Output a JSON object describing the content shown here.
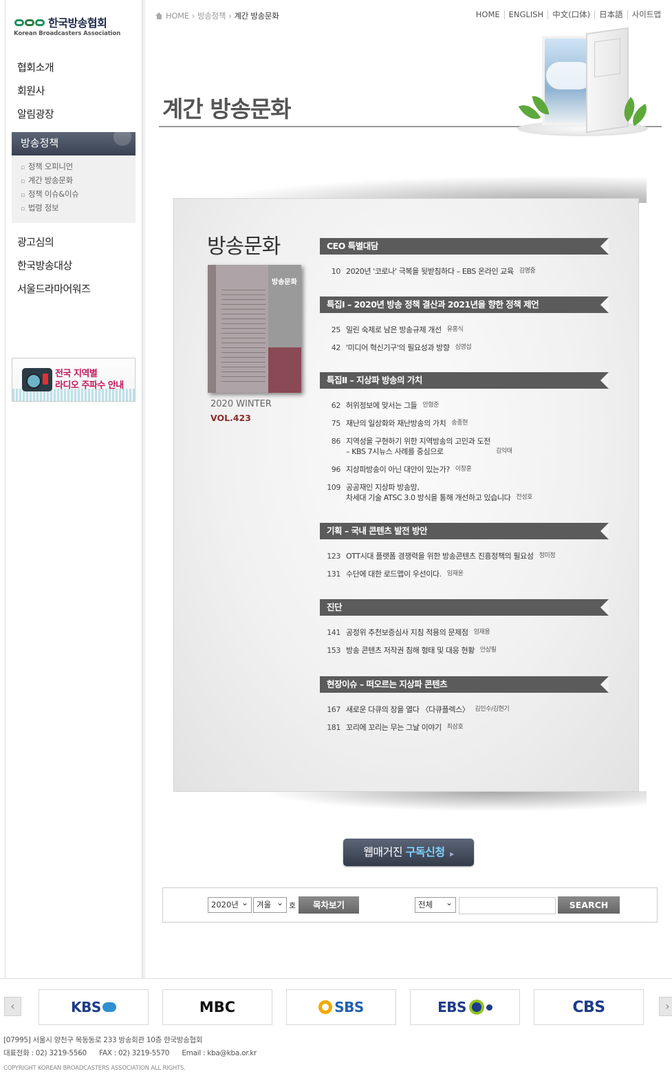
{
  "logo": {
    "ko": "한국방송협회",
    "en": "Korean Broadcasters Association"
  },
  "sidebar": {
    "top_items": [
      "협회소개",
      "회원사",
      "알림광장"
    ],
    "active_item": "방송정책",
    "sub_items": [
      "정책 오피니언",
      "계간 방송문화",
      "정책 이슈&이슈",
      "법령 정보"
    ],
    "bottom_items": [
      "광고심의",
      "한국방송대상",
      "서울드라마어워즈"
    ],
    "banner_line1": "전국 지역별",
    "banner_line2": "라디오 주파수 안내"
  },
  "breadcrumb": {
    "home": "HOME",
    "parent": "방송정책",
    "current": "계간 방송문화"
  },
  "topmenu": [
    "HOME",
    "ENGLISH",
    "中文(口体)",
    "日本語",
    "사이트맵"
  ],
  "page_title": "계간 방송문화",
  "magazine": {
    "title": "방송문화",
    "cover_title": "방송문화",
    "season": "2020 WINTER",
    "volume": "VOL.423",
    "sections": [
      {
        "title": "CEO 특별대담",
        "items": [
          {
            "page": "10",
            "title": "2020년 '코로나' 극복을 뒷받침하다 – EBS 온라인 교육",
            "author": "김명중"
          }
        ]
      },
      {
        "title": "특집Ⅰ – 2020년 방송 정책 결산과 2021년을 향한 정책 제언",
        "items": [
          {
            "page": "25",
            "title": "밀린 숙제로 남은 방송규제 개선",
            "author": "유홍식"
          },
          {
            "page": "42",
            "title": "'미디어 혁신기구'의 필요성과 방향",
            "author": "심영섭"
          }
        ]
      },
      {
        "title": "특집Ⅱ – 지상파 방송의 가치",
        "items": [
          {
            "page": "62",
            "title": "허위정보에 맞서는 그들",
            "author": "안형준"
          },
          {
            "page": "75",
            "title": "재난의 일상화와 재난방송의 가치",
            "author": "송종현"
          },
          {
            "page": "86",
            "title": "지역성을 구현하기 위한 지역방송의 고민과 도전\n– KBS 7시뉴스 사례를 중심으로",
            "author": "김익태"
          },
          {
            "page": "96",
            "title": "지상파방송이 아닌 대안이 있는가?",
            "author": "이창훈"
          },
          {
            "page": "109",
            "title": "공공재인 지상파 방송망,\n차세대 기술 ATSC 3.0 방식을 통해 개선하고 있습니다",
            "author": "전성호"
          }
        ]
      },
      {
        "title": "기획 – 국내 콘텐츠 발전 방안",
        "items": [
          {
            "page": "123",
            "title": "OTT시대 플랫폼 경쟁력을 위한 방송콘텐츠 진흥정책의 필요성",
            "author": "정미정"
          },
          {
            "page": "131",
            "title": "수단에 대한 로드맵이 우선이다.",
            "author": "임재윤"
          }
        ]
      },
      {
        "title": "진단",
        "items": [
          {
            "page": "141",
            "title": "공정위 추천보증심사 지침 적용의 문제점",
            "author": "엄재용"
          },
          {
            "page": "153",
            "title": "방송 콘텐츠 저작권 침해 형태 및 대응 현황",
            "author": "안상필"
          }
        ]
      },
      {
        "title": "현장이슈 – 떠오르는 지상파 콘텐츠",
        "items": [
          {
            "page": "167",
            "title": "새로운 다큐의 장을 열다 〈다큐플렉스〉",
            "author": "김인수/김현기"
          },
          {
            "page": "181",
            "title": "꼬리에 꼬리는 무는 그날 이야기",
            "author": "최삼호"
          }
        ]
      }
    ]
  },
  "subscribe": {
    "prefix": "웹매거진",
    "highlight": "구독신청"
  },
  "search": {
    "year": "2020년",
    "season": "겨울",
    "ho_label": "호",
    "toc_button": "목차보기",
    "scope": "전체",
    "query": "",
    "search_button": "SEARCH"
  },
  "footer": {
    "broadcasters": [
      "KBS",
      "MBC",
      "SBS",
      "EBS",
      "CBS"
    ],
    "address": "[07995] 서울시 양천구 목동동로 233 방송회관 10층 한국방송협회",
    "contact": "대표전화 : 02) 3219-5560      FAX : 02) 3219-5570      Email : kba@kba.or.kr",
    "copyright": "COPYRIGHT  KOREAN BROADCASTERS ASSOCIATION  ALL RIGHTS."
  }
}
